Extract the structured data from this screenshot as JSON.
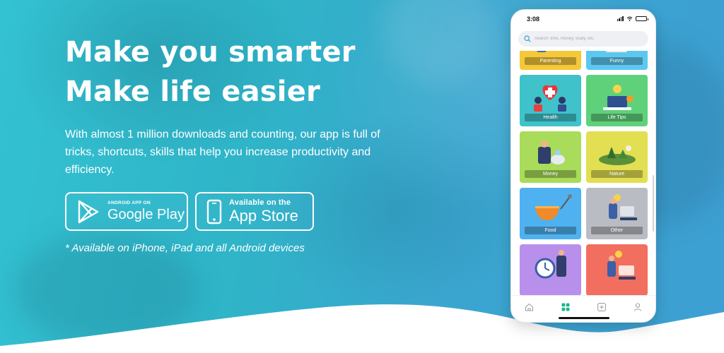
{
  "hero": {
    "headline": [
      "Make you smarter",
      "Make life easier"
    ],
    "description": "With almost 1 million downloads and counting, our app is full of tricks, shortcuts, skills that help you increase productivity and efficiency.",
    "note": "* Available on iPhone, iPad and all Android devices"
  },
  "buttons": {
    "google_play": {
      "small": "ANDROID APP ON",
      "big": "Google Play"
    },
    "app_store": {
      "small": "Available on the",
      "big": "App Store"
    }
  },
  "phone": {
    "time": "3:08",
    "search_placeholder": "Search: time, money, study, etc.",
    "categories": [
      {
        "label": "Parenting",
        "color": "#f5c83a",
        "art": "parenting"
      },
      {
        "label": "Funny",
        "color": "#5cc8f0",
        "art": "funny"
      },
      {
        "label": "Health",
        "color": "#3fc2c9",
        "art": "health"
      },
      {
        "label": "Life Tips",
        "color": "#5fd17a",
        "art": "lifetips"
      },
      {
        "label": "Money",
        "color": "#a8dc5a",
        "art": "money"
      },
      {
        "label": "Nature",
        "color": "#e2df52",
        "art": "nature"
      },
      {
        "label": "Food",
        "color": "#4fb1ef",
        "art": "food"
      },
      {
        "label": "Other",
        "color": "#b9bcc2",
        "art": "other"
      },
      {
        "label": "",
        "color": "#b890ec",
        "art": "clock"
      },
      {
        "label": "",
        "color": "#f26e5e",
        "art": "person"
      }
    ],
    "tabs": [
      "home-icon",
      "grid-icon",
      "plus-square-icon",
      "profile-icon"
    ],
    "accent": "#1fb48a"
  }
}
